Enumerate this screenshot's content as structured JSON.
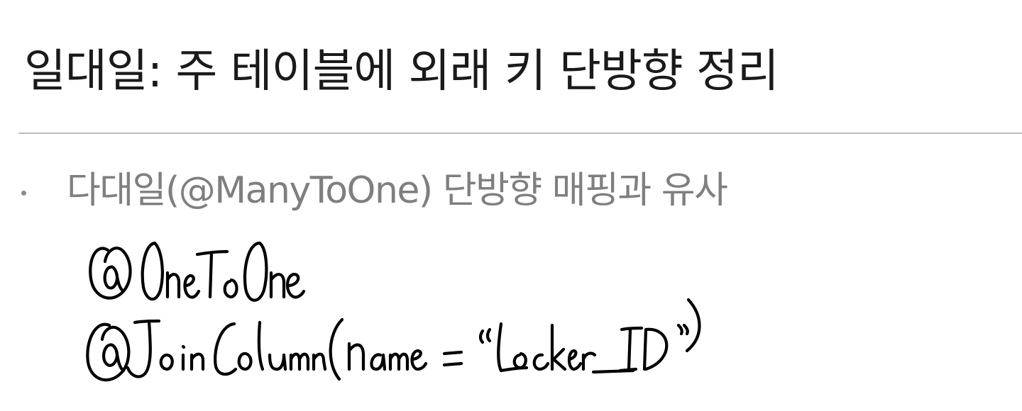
{
  "slide": {
    "title": "일대일: 주 테이블에 외래 키 단방향 정리",
    "bullets": [
      {
        "text": "다대일(@ManyToOne) 단방향 매핑과 유사"
      }
    ],
    "handwritten_note": {
      "lines": [
        "@OneToOne",
        "@JoinColumn(name = \"Locker_ID\")"
      ]
    }
  }
}
